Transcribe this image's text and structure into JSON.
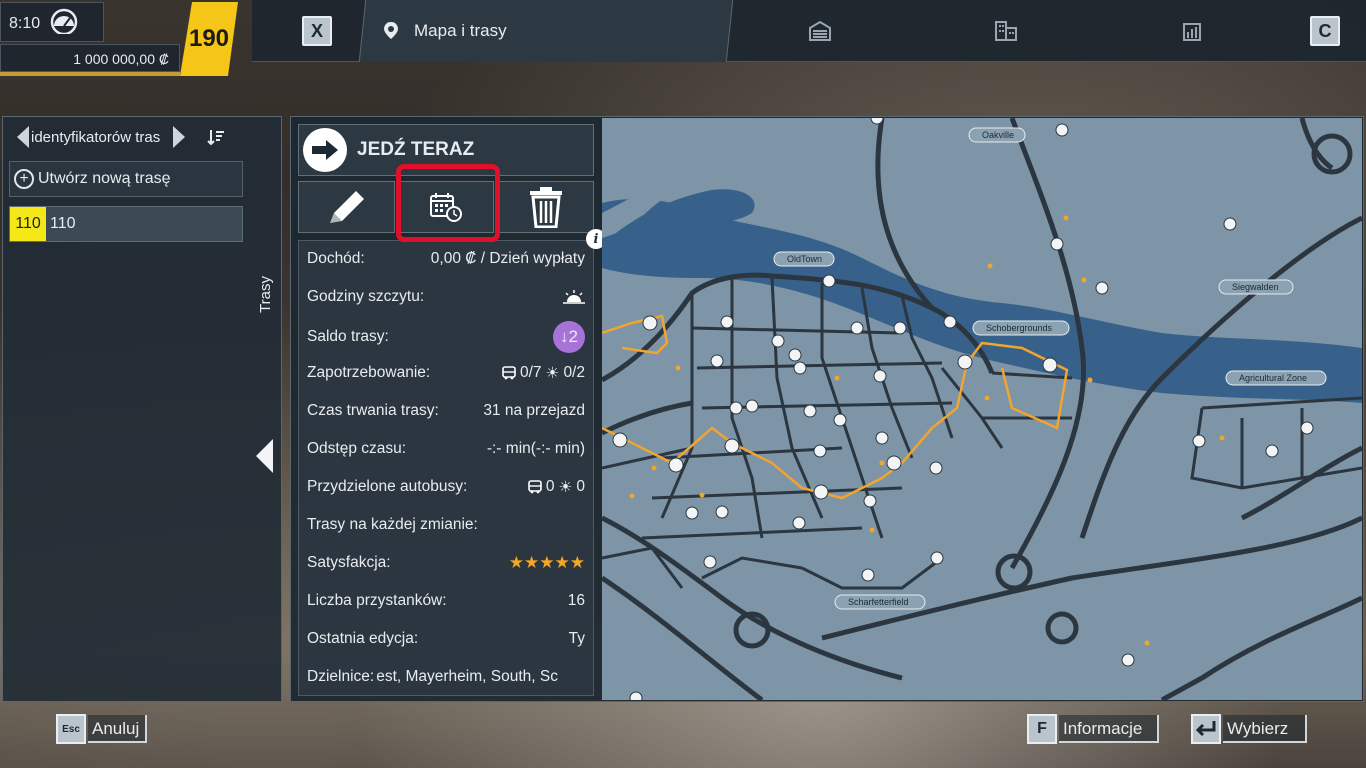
{
  "status": {
    "time": "8:10",
    "money": "1 000 000,00 ₡",
    "level": "190"
  },
  "topbar": {
    "close_key": "X",
    "active_tab": "Mapa i trasy",
    "next_key": "C",
    "tab_icons": [
      "depot-icon",
      "buildings-icon",
      "stats-chart-icon"
    ]
  },
  "sidebar": {
    "sort_label": "identyfikatorów tras",
    "new_route_label": "Utwórz nową trasę",
    "routes": [
      {
        "badge": "110",
        "name": "110",
        "badge_color": "#f5e817"
      }
    ],
    "tab_label": "Trasy"
  },
  "route_details": {
    "go_button": "JEDŹ TERAZ",
    "actions": [
      "edit-icon",
      "schedule-icon",
      "delete-icon"
    ],
    "stats": [
      {
        "label": "Dochód:",
        "value": "0,00 ₡ / Dzień wypłaty"
      },
      {
        "label": "Godziny szczytu:",
        "value": ""
      },
      {
        "label": "Saldo trasy:",
        "value": "↓2"
      },
      {
        "label": "Zapotrzebowanie:",
        "value_bus": "0/7",
        "value_night": "0/2"
      },
      {
        "label": "Czas trwania trasy:",
        "value": "31 na przejazd"
      },
      {
        "label": "Odstęp czasu:",
        "value": "-:- min(-:- min)"
      },
      {
        "label": "Przydzielone autobusy:",
        "value_bus": "0",
        "value_night": "0"
      },
      {
        "label": "Trasy na każdej zmianie:",
        "value": ""
      },
      {
        "label": "Satysfakcja:",
        "value": "★★★★★"
      },
      {
        "label": "Liczba przystanków:",
        "value": "16"
      },
      {
        "label": "Ostatnia edycja:",
        "value": "Ty"
      },
      {
        "label": "Dzielnice:",
        "value": "est, Mayerheim, South, Sc"
      }
    ],
    "satisfaction_stars": 5
  },
  "map": {
    "districts": [
      "Oakville",
      "OldTown",
      "Siegwalden",
      "Schobergrounds",
      "Agricultural Zone",
      "Scharfetterfield"
    ],
    "colors": {
      "land": "#7d95a6",
      "water": "#37618a",
      "roads": "#2b3640",
      "route": "#f0a530"
    }
  },
  "bottom": {
    "cancel_key": "Esc",
    "cancel_label": "Anuluj",
    "info_key": "F",
    "info_label": "Informacje",
    "select_label": "Wybierz"
  }
}
